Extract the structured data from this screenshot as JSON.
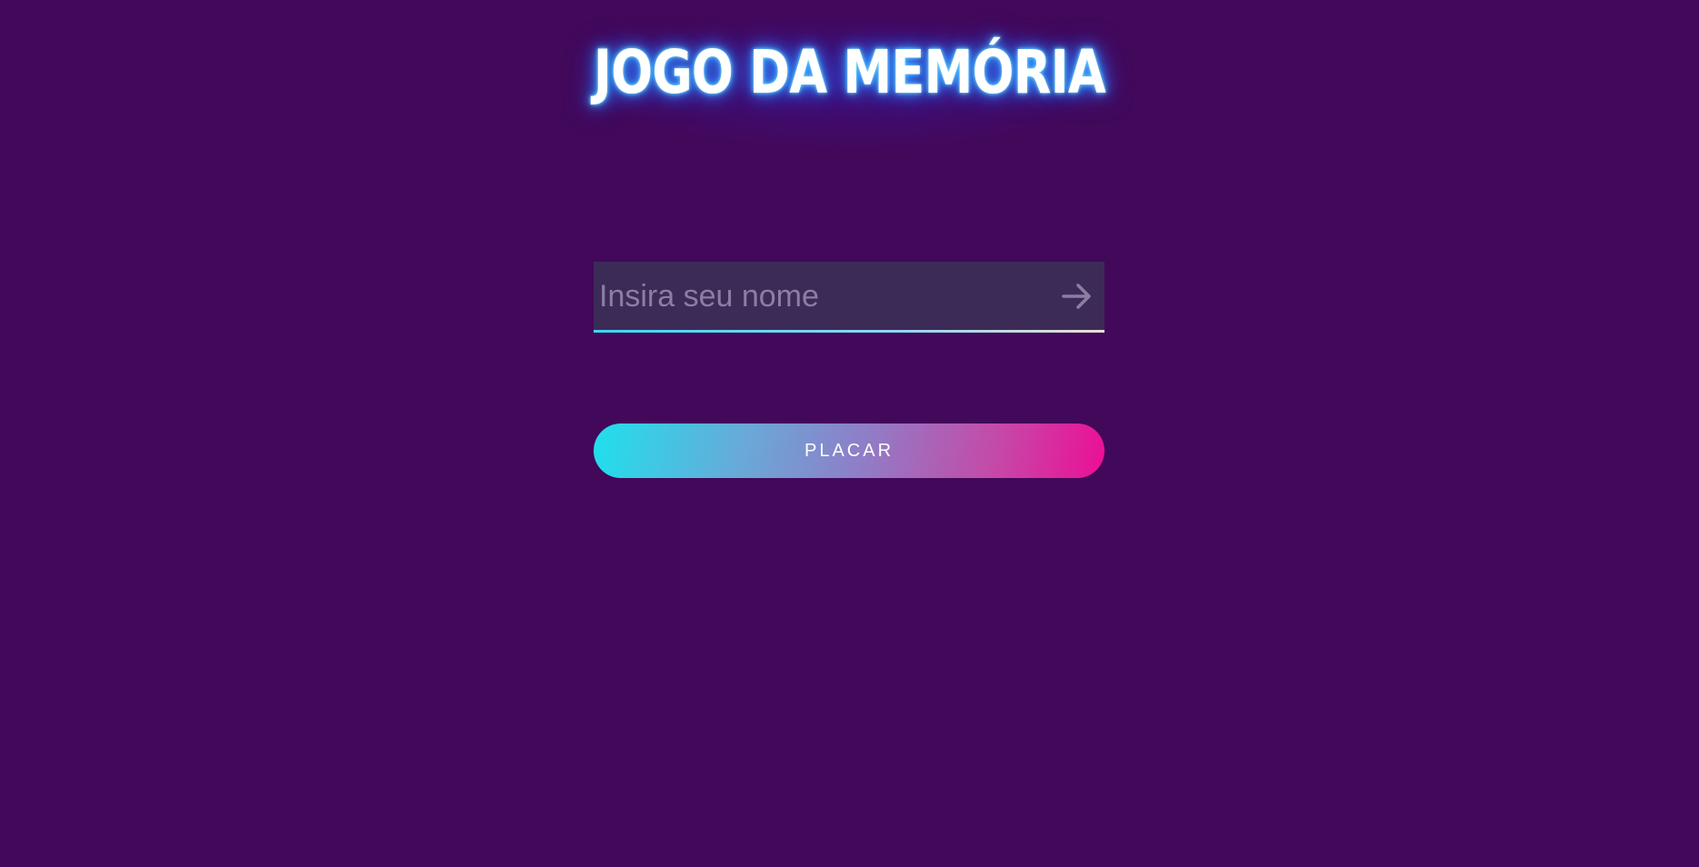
{
  "title": "JOGO DA MEMÓRIA",
  "name_input": {
    "placeholder": "Insira seu nome",
    "value": ""
  },
  "submit_icon": "arrow-right-icon",
  "scoreboard_button": {
    "label": "PLACAR"
  },
  "colors": {
    "background": "#42085a",
    "input_background": "#3d2b57",
    "button_gradient_start": "#1fe0ec",
    "button_gradient_end": "#ec0e96",
    "title_glow": "#3fb4ff"
  }
}
